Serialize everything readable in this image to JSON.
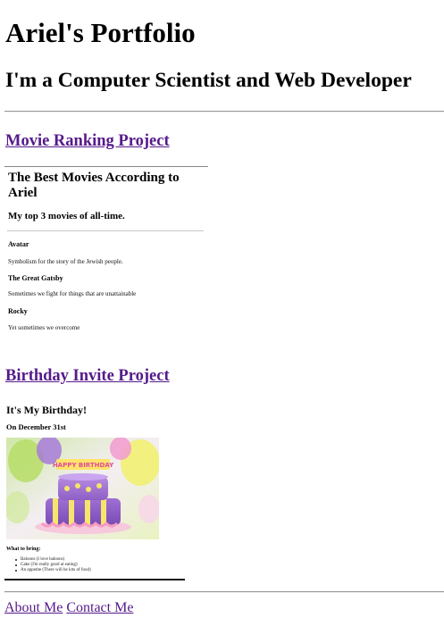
{
  "header": {
    "title": "Ariel's Portfolio",
    "subtitle": "I'm a Computer Scientist and Web Developer"
  },
  "projects": [
    {
      "link_label": "Movie Ranking Project",
      "preview": {
        "title": "The Best Movies According to Ariel",
        "subtitle": "My top 3 movies of all-time.",
        "movies": [
          {
            "name": "Avatar",
            "description": "Symbolism for the story of the Jewish people."
          },
          {
            "name": "The Great Gatsby",
            "description": "Sometimes we fight for things that are unattainable"
          },
          {
            "name": "Rocky",
            "description": "Yet sometimes we overcome"
          }
        ]
      }
    },
    {
      "link_label": "Birthday Invite Project",
      "preview": {
        "title": "It's My Birthday!",
        "date": "On December 31st",
        "image": {
          "subject": "birthday-cake-icon",
          "banner_text": "HAPPY BIRTHDAY"
        },
        "bring_label": "What to bring:",
        "items": [
          "Baloons (I love baloons)",
          "Cake (I'm really good at eating)",
          "An appetite (There will be lots of food)"
        ]
      }
    }
  ],
  "footer": {
    "links": [
      "About Me",
      "Contact Me"
    ]
  },
  "colors": {
    "visited_link": "#551a8b",
    "divider": "#9a9a9a"
  }
}
